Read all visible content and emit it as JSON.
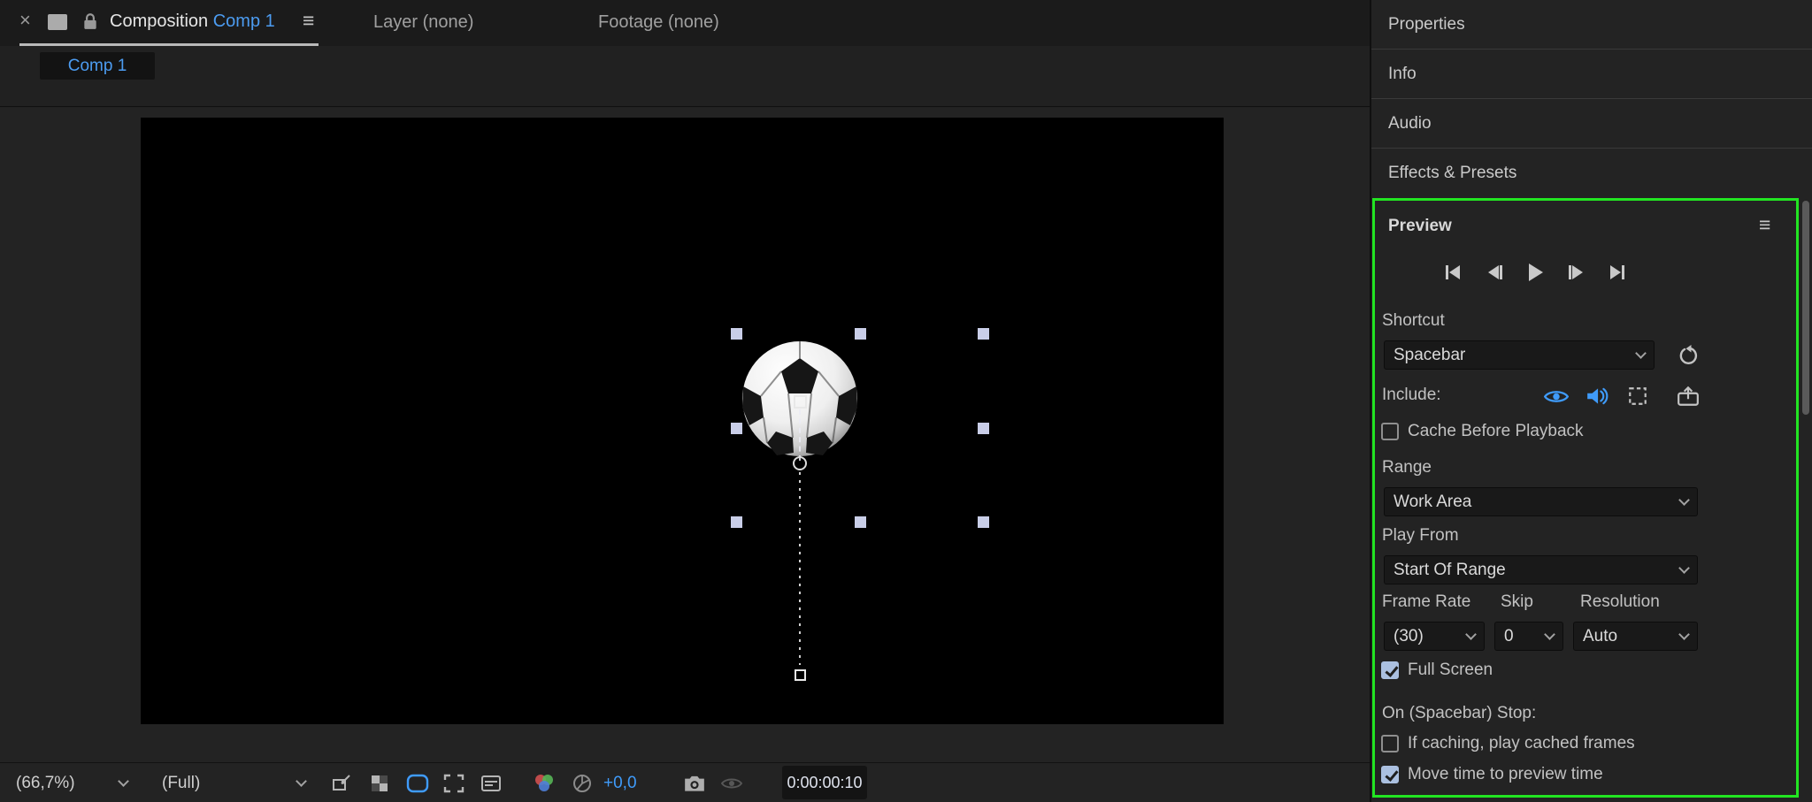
{
  "colors": {
    "accent_blue": "#3f9bfa",
    "highlight_green": "#22e522",
    "checkbox_checked": "#abc0e0",
    "comp_background": "#000000"
  },
  "icons": {
    "close": "×",
    "menu": "≡"
  },
  "viewer": {
    "tabs": {
      "composition_label": "Composition",
      "composition_name": "Comp 1",
      "layer": "Layer (none)",
      "footage": "Footage (none)"
    },
    "comp_button": "Comp 1",
    "toolbar": {
      "zoom": "(66,7%)",
      "resolution": "(Full)",
      "exposure": "+0,0",
      "timecode": "0:00:00:10"
    }
  },
  "sidebar": {
    "panels": [
      "Properties",
      "Info",
      "Audio",
      "Effects & Presets"
    ]
  },
  "preview": {
    "title": "Preview",
    "shortcut_label": "Shortcut",
    "shortcut_value": "Spacebar",
    "include_label": "Include:",
    "cache_label": "Cache Before Playback",
    "range_label": "Range",
    "range_value": "Work Area",
    "play_from_label": "Play From",
    "play_from_value": "Start Of Range",
    "frame_rate_label": "Frame Rate",
    "skip_label": "Skip",
    "resolution_label": "Resolution",
    "frame_rate_value": "(30)",
    "skip_value": "0",
    "resolution_value": "Auto",
    "full_screen_label": "Full Screen",
    "on_stop_label": "On (Spacebar) Stop:",
    "if_caching_label": "If caching, play cached frames",
    "move_time_label": "Move time to preview time",
    "states": {
      "cache_before_playback": false,
      "full_screen": true,
      "if_caching_play_cached": false,
      "move_time_to_preview": true
    }
  }
}
